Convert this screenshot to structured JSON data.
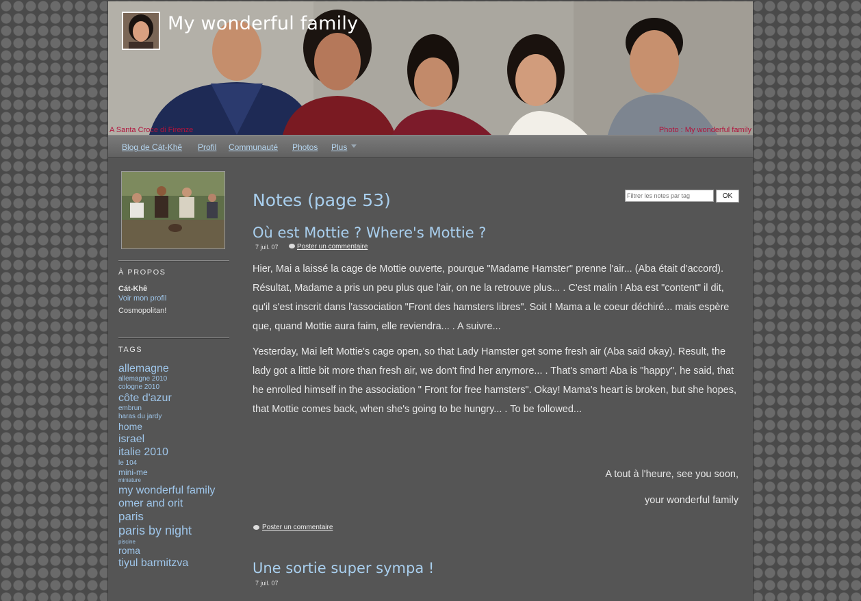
{
  "header": {
    "site_title": "My wonderful family",
    "caption_left": "A Santa Croce di Firenze",
    "caption_right": "Photo : My wonderful family"
  },
  "nav": {
    "items": [
      "Blog de Cát-Khê",
      "Profil",
      "Communauté",
      "Photos",
      "Plus"
    ]
  },
  "sidebar": {
    "about_heading": "À PROPOS",
    "name": "Cát-Khê",
    "profile_link": "Voir mon profil",
    "description": "Cosmopolitan!",
    "tags_heading": "TAGS",
    "tags": [
      {
        "label": "allemagne",
        "size": 16
      },
      {
        "label": "allemagne 2010",
        "size": 10
      },
      {
        "label": "cologne 2010",
        "size": 10
      },
      {
        "label": "côte d'azur",
        "size": 16
      },
      {
        "label": "embrun",
        "size": 10
      },
      {
        "label": "haras du jardy",
        "size": 10
      },
      {
        "label": "home",
        "size": 14
      },
      {
        "label": "israel",
        "size": 16
      },
      {
        "label": "italie 2010",
        "size": 16
      },
      {
        "label": "le 104",
        "size": 10
      },
      {
        "label": "mini-me",
        "size": 12
      },
      {
        "label": "miniature",
        "size": 8
      },
      {
        "label": "my wonderful family",
        "size": 16
      },
      {
        "label": "omer and orit",
        "size": 16
      },
      {
        "label": "paris",
        "size": 17
      },
      {
        "label": "paris by night",
        "size": 18
      },
      {
        "label": "piscine",
        "size": 8
      },
      {
        "label": "roma",
        "size": 14
      },
      {
        "label": "tiyul barmitzva",
        "size": 16
      }
    ]
  },
  "filter": {
    "placeholder": "Filtrer les notes par tag",
    "button": "OK"
  },
  "main": {
    "page_title": "Notes (page 53)",
    "post1": {
      "title": "Où est Mottie ? Where's Mottie ?",
      "date": "7 juil. 07",
      "comment_link": "Poster un commentaire",
      "para_fr": "Hier, Mai a laissé la cage de Mottie ouverte, pourque \"Madame Hamster\" prenne l'air... (Aba était d'accord). Résultat, Madame a pris un peu plus que l'air, on ne la retrouve plus... . C'est malin ! Aba est \"content\" il dit, qu'il s'est inscrit dans l'association \"Front des hamsters libres\". Soit ! Mama a le coeur déchiré... mais espère que, quand Mottie aura faim, elle reviendra... . A suivre...",
      "para_en": "Yesterday, Mai left Mottie's cage open, so that Lady Hamster get some fresh air (Aba said okay). Result, the lady got a little bit more than fresh air, we don't find her anymore... . That's smart! Aba is \"happy\", he said, that he enrolled himself in the association \" Front for free hamsters\". Okay! Mama's heart is broken, but she hopes, that Mottie comes back, when she's going to be hungry... . To be followed...",
      "signoff_1": "A tout à l'heure, see you soon,",
      "signoff_2": "your wonderful family",
      "comment_link_bottom": "Poster un commentaire"
    },
    "post2": {
      "title": "Une sortie super sympa !",
      "date": "7 juil. 07"
    }
  }
}
